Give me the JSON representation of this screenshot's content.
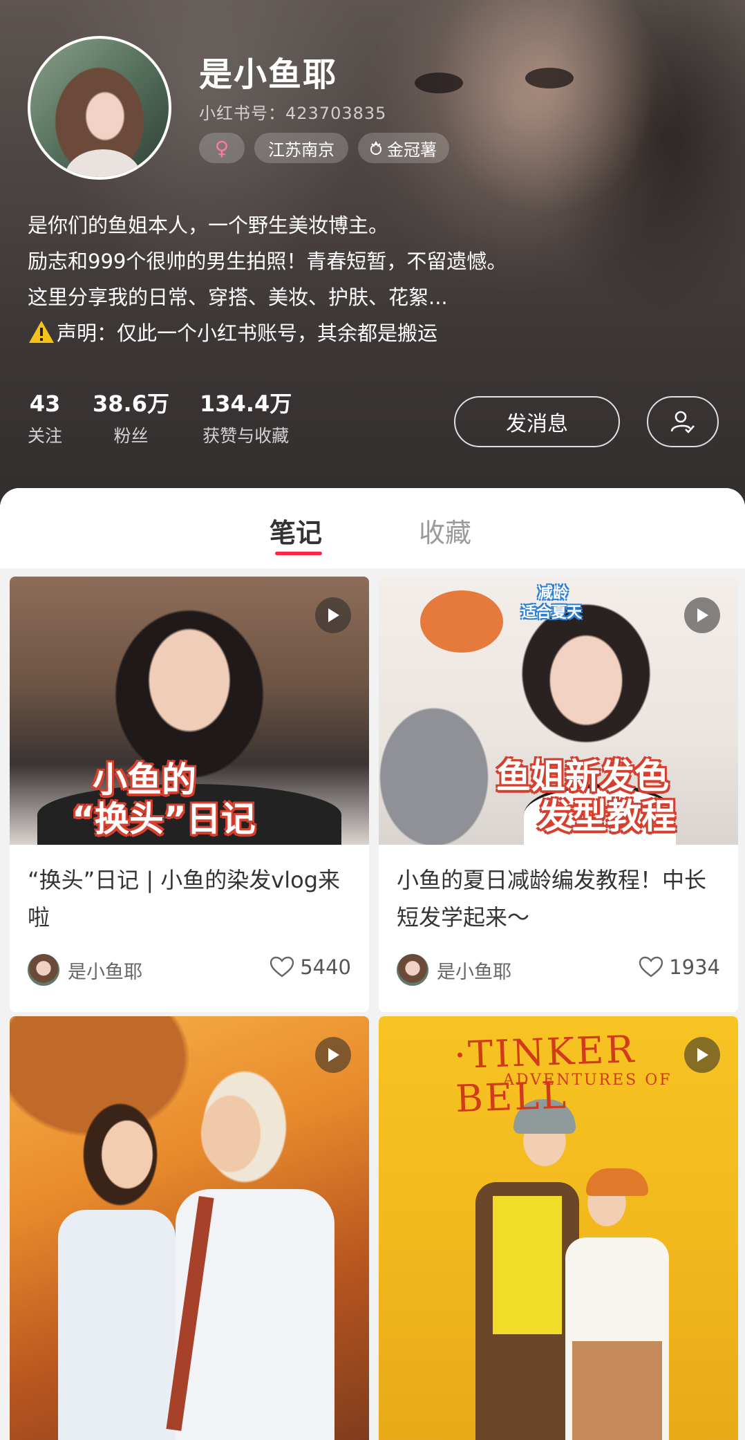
{
  "profile": {
    "name": "是小鱼耶",
    "red_id": "小红书号：423703835",
    "gender_symbol": "♀",
    "location": "江苏南京",
    "badge": "金冠薯",
    "bio": [
      "是你们的鱼姐本人，一个野生美妆博主。",
      "励志和999个很帅的男生拍照！青春短暂，不留遗憾。",
      "这里分享我的日常、穿搭、美妆、护肤、花絮..."
    ],
    "notice": "声明：仅此一个小红书账号，其余都是搬运",
    "stats": [
      {
        "value": "43",
        "label": "关注"
      },
      {
        "value": "38.6万",
        "label": "粉丝"
      },
      {
        "value": "134.4万",
        "label": "获赞与收藏"
      }
    ],
    "message_button": "发消息"
  },
  "tabs": {
    "notes": "笔记",
    "collections": "收藏"
  },
  "cards": [
    {
      "title": "“换头”日记 | 小鱼的染发vlog来啦",
      "author": "是小鱼耶",
      "likes": "5440",
      "overlay_line1": "小鱼的",
      "overlay_line2": "“换头”日记"
    },
    {
      "title": "小鱼的夏日减龄编发教程！中长短发学起来～",
      "author": "是小鱼耶",
      "likes": "1934",
      "caption_line1": "减龄",
      "caption_line2": "适合夏天",
      "overlay_line1": "鱼姐新发色",
      "overlay_line2": "发型教程"
    },
    {
      "title": "",
      "author": "",
      "likes": ""
    },
    {
      "title": "",
      "author": "",
      "likes": "",
      "overlay_title": "·TINKER BELL",
      "overlay_sub": "ADVENTURES OF"
    }
  ],
  "icons": {
    "play": "play-icon",
    "heart": "heart-icon",
    "warning": "warning-icon",
    "follow": "user-check-icon",
    "crown": "crown-icon"
  },
  "colors": {
    "accent": "#ff2442",
    "header_bg": "#3d3737",
    "card_bg": "#ffffff"
  }
}
